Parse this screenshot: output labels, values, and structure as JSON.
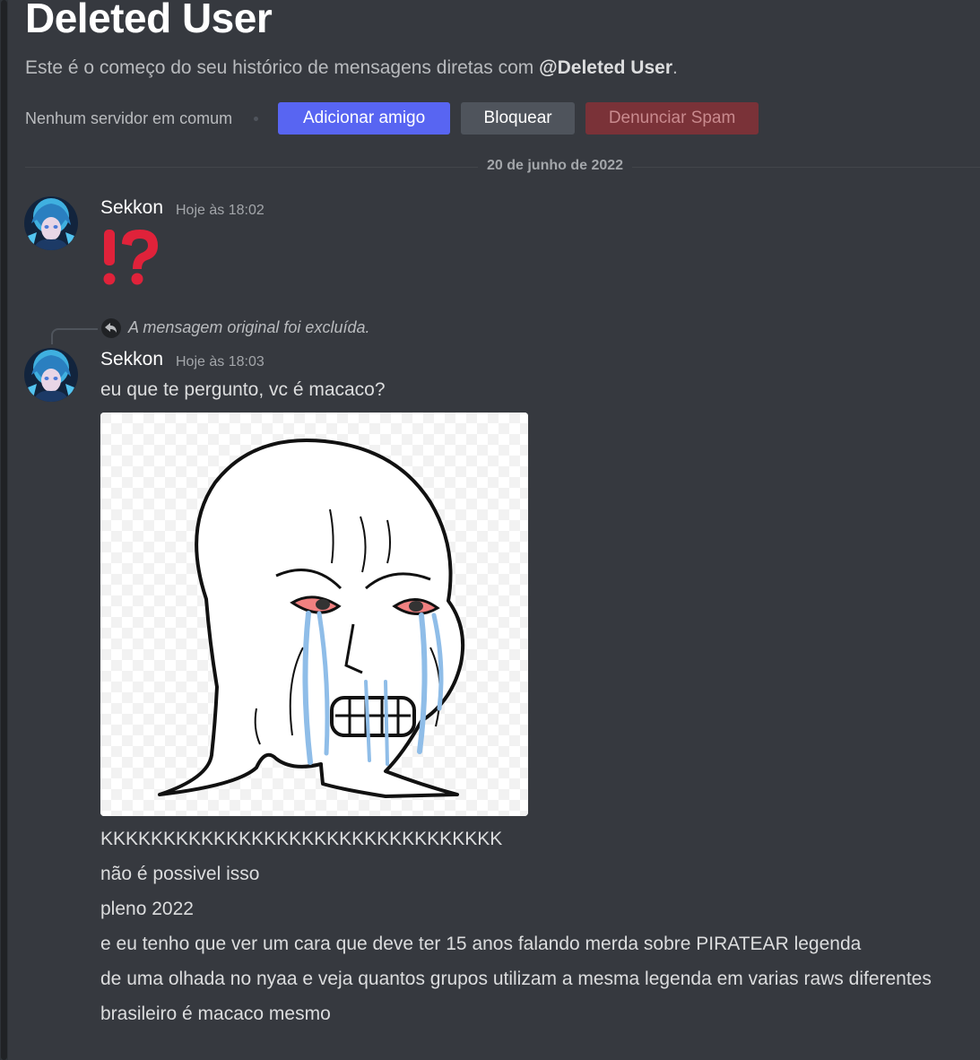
{
  "header": {
    "title": "Deleted User",
    "intro_prefix": "Este é o começo do seu histórico de mensagens diretas com ",
    "intro_username": "@Deleted User",
    "intro_suffix": "."
  },
  "actions": {
    "mutual_servers": "Nenhum servidor em comum",
    "add_friend": "Adicionar amigo",
    "block": "Bloquear",
    "report_spam": "Denunciar Spam"
  },
  "date_divider": "20 de junho de 2022",
  "messages": [
    {
      "author": "Sekkon",
      "timestamp": "Hoje às 18:02",
      "emoji": "interrobang-icon"
    },
    {
      "reply_notice": "A mensagem original foi excluída.",
      "author": "Sekkon",
      "timestamp": "Hoje às 18:03",
      "lines": [
        "eu que te pergunto, vc é macaco?"
      ],
      "attachment": "crying-wojak-meme"
    }
  ],
  "followups": [
    "KKKKKKKKKKKKKKKKKKKKKKKKKKKKKKKK",
    "não é possivel isso",
    "pleno 2022",
    "e eu tenho que ver um cara que deve ter 15 anos falando merda sobre PIRATEAR legenda",
    "de uma olhada no nyaa e veja quantos grupos utilizam a mesma legenda em varias raws diferentes",
    "brasileiro é macaco mesmo"
  ],
  "colors": {
    "background": "#36393f",
    "brand": "#5865f2",
    "danger": "#7a3238",
    "interrobang": "#e0223a"
  }
}
